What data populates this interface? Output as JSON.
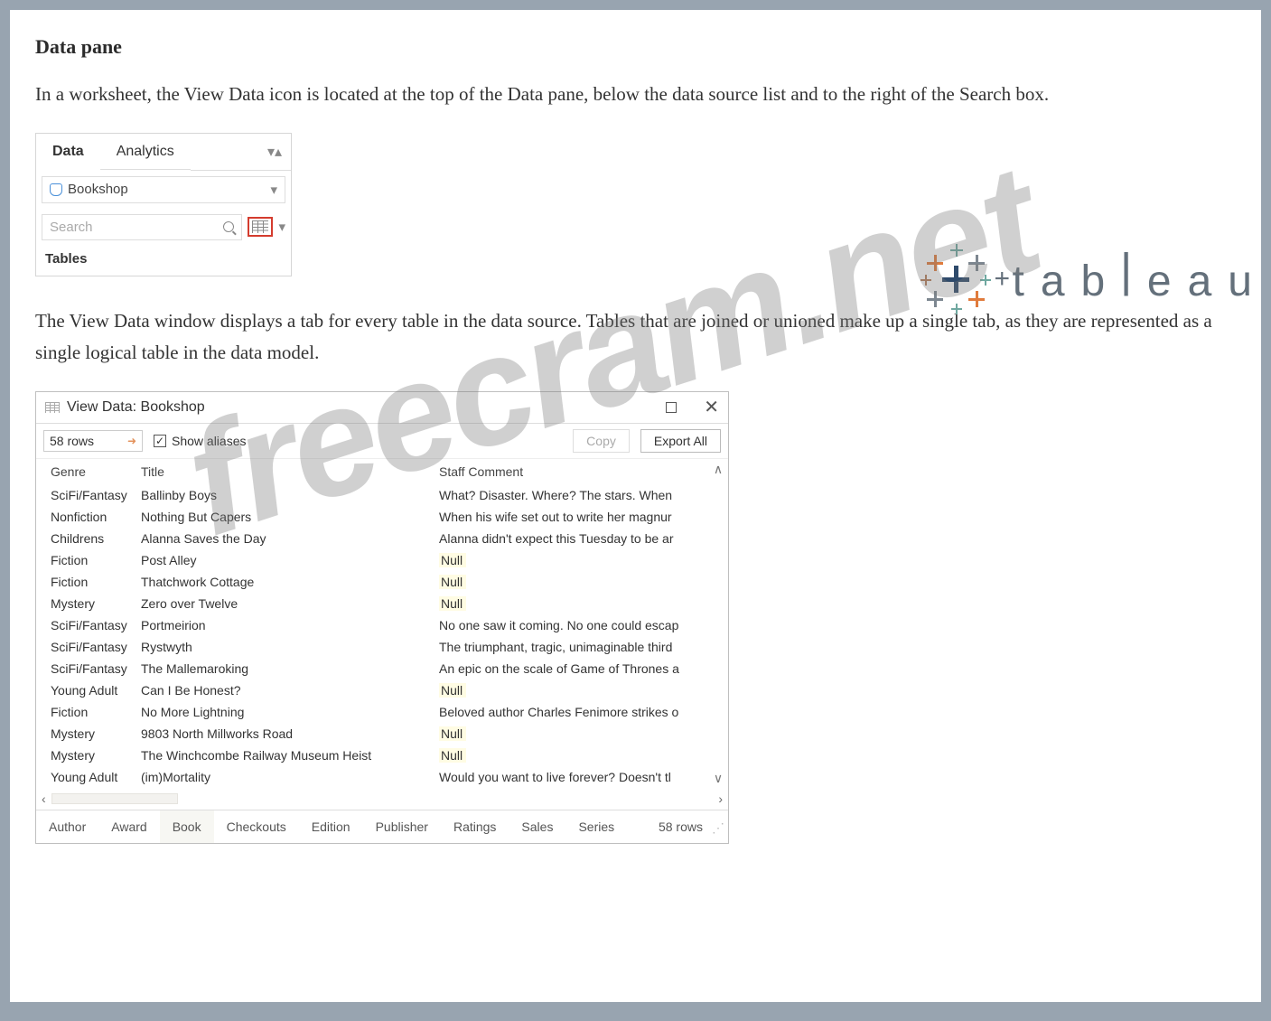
{
  "title": "Data pane",
  "paragraph1": "In a worksheet, the View Data icon is located at the top of the Data pane, below the data source list and to the right of the Search box.",
  "paragraph2": "The View Data window displays a tab for every table in the data source. Tables that are joined or unioned make up a single tab, as they are represented as a single logical table in the data model.",
  "watermark": "freecram.net",
  "tableau_word": [
    "t",
    "a",
    "b",
    "l",
    "e",
    "a",
    "u"
  ],
  "dataPane": {
    "tabs": {
      "data": "Data",
      "analytics": "Analytics"
    },
    "source": "Bookshop",
    "search_placeholder": "Search",
    "tables_label": "Tables"
  },
  "viewData": {
    "title": "View Data: Bookshop",
    "rows_input": "58 rows",
    "show_aliases": "Show aliases",
    "copy": "Copy",
    "export_all": "Export All",
    "headers": {
      "genre": "Genre",
      "title": "Title",
      "staff": "Staff Comment"
    },
    "rows": [
      {
        "genre": "SciFi/Fantasy",
        "title": "Ballinby Boys",
        "staff": "What? Disaster. Where? The stars. When"
      },
      {
        "genre": "Nonfiction",
        "title": "Nothing But Capers",
        "staff": "When his wife set out to write her magnur"
      },
      {
        "genre": "Childrens",
        "title": "Alanna Saves the Day",
        "staff": "Alanna didn't expect this Tuesday to be ar"
      },
      {
        "genre": "Fiction",
        "title": "Post Alley",
        "staff": "Null",
        "isNull": true
      },
      {
        "genre": "Fiction",
        "title": "Thatchwork Cottage",
        "staff": "Null",
        "isNull": true
      },
      {
        "genre": "Mystery",
        "title": "Zero over Twelve",
        "staff": "Null",
        "isNull": true
      },
      {
        "genre": "SciFi/Fantasy",
        "title": "Portmeirion",
        "staff": "No one saw it coming. No one could escap"
      },
      {
        "genre": "SciFi/Fantasy",
        "title": "Rystwyth",
        "staff": "The triumphant, tragic, unimaginable third"
      },
      {
        "genre": "SciFi/Fantasy",
        "title": "The Mallemaroking",
        "staff": "An epic on the scale of Game of Thrones a"
      },
      {
        "genre": "Young Adult",
        "title": "Can I Be Honest?",
        "staff": "Null",
        "isNull": true
      },
      {
        "genre": "Fiction",
        "title": "No More Lightning",
        "staff": "Beloved author Charles Fenimore strikes o"
      },
      {
        "genre": "Mystery",
        "title": "9803 North Millworks Road",
        "staff": "Null",
        "isNull": true
      },
      {
        "genre": "Mystery",
        "title": "The Winchcombe Railway Museum Heist",
        "staff": "Null",
        "isNull": true
      },
      {
        "genre": "Young Adult",
        "title": "(im)Mortality",
        "staff": "Would you want to live forever? Doesn't tl"
      }
    ],
    "tabs": [
      "Author",
      "Award",
      "Book",
      "Checkouts",
      "Edition",
      "Publisher",
      "Ratings",
      "Sales",
      "Series"
    ],
    "footer_rows": "58 rows"
  }
}
